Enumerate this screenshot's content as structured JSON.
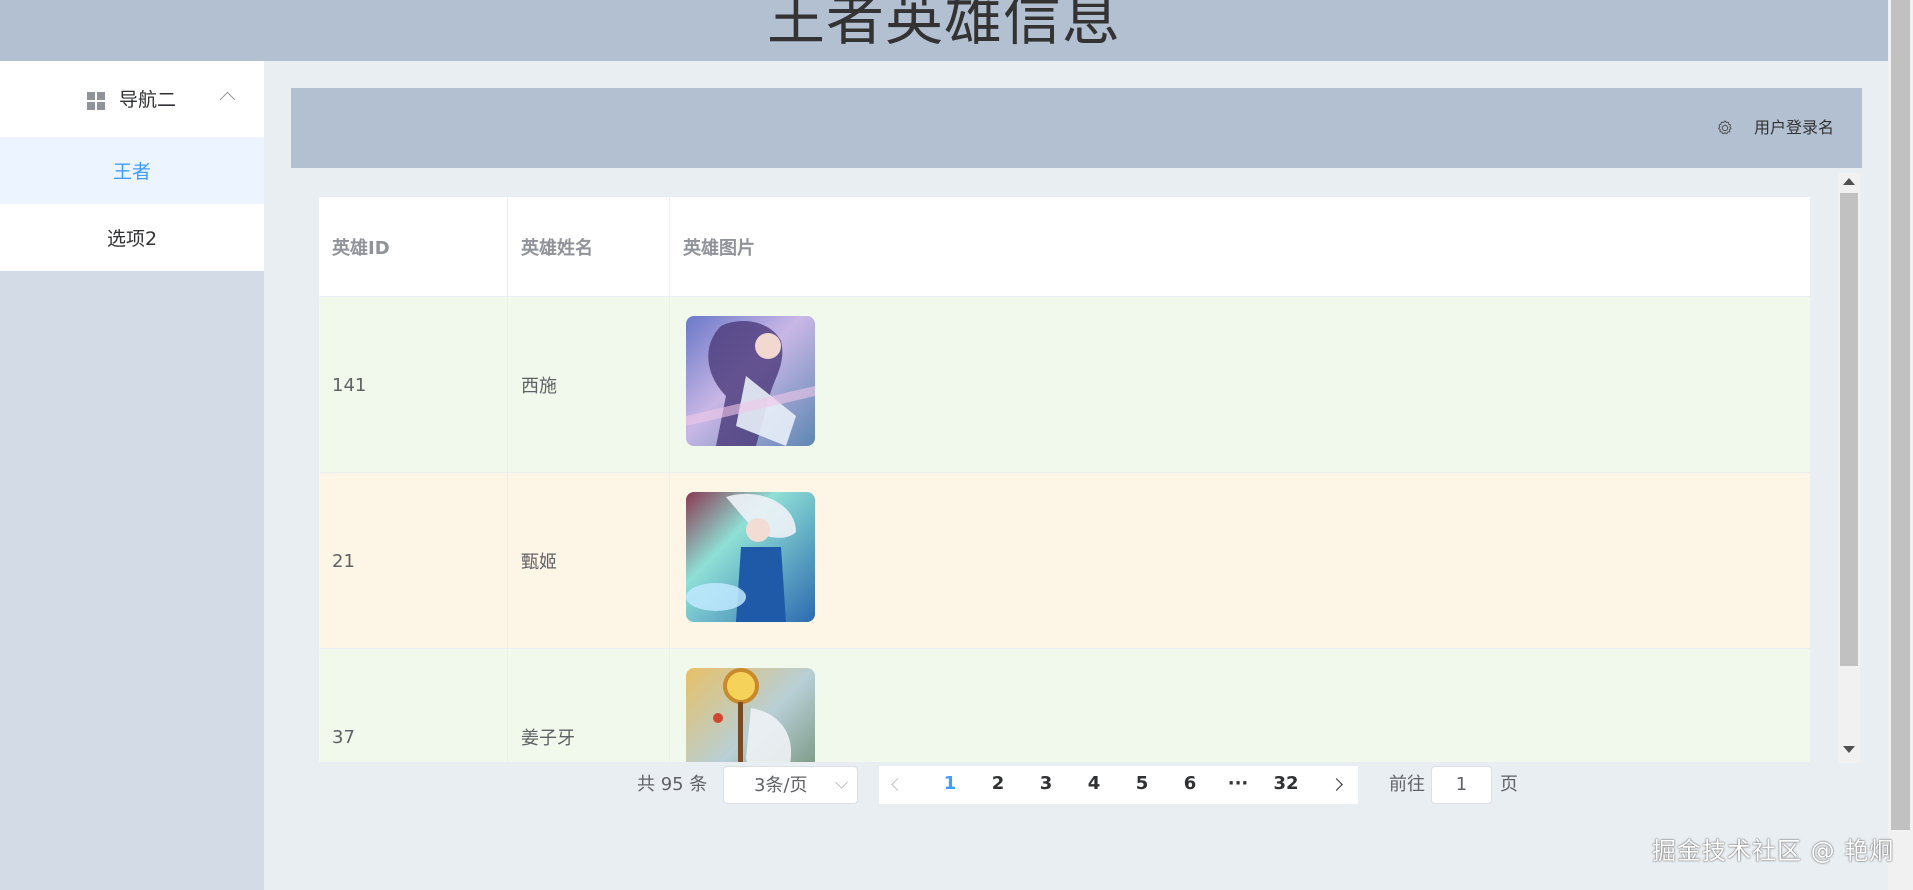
{
  "header": {
    "title": "王者英雄信息"
  },
  "sidebar": {
    "submenu": {
      "label": "导航二"
    },
    "items": [
      {
        "label": "王者",
        "active": true
      },
      {
        "label": "选项2",
        "active": false
      }
    ]
  },
  "topbar": {
    "user_label": "用户登录名"
  },
  "table": {
    "columns": [
      "英雄ID",
      "英雄姓名",
      "英雄图片"
    ],
    "rows": [
      {
        "id": "141",
        "name": "西施"
      },
      {
        "id": "21",
        "name": "甄姬"
      },
      {
        "id": "37",
        "name": "姜子牙"
      }
    ]
  },
  "pagination": {
    "total": "共 95 条",
    "page_size": "3条/页",
    "pages": [
      "1",
      "2",
      "3",
      "4",
      "5",
      "6",
      "···",
      "32"
    ],
    "current": "1",
    "jump_prefix": "前往",
    "jump_value": "1",
    "jump_suffix": "页"
  },
  "watermark": "掘金技术社区 @ 艳炯",
  "colors": {
    "header_bg": "#b3c0d1",
    "sidebar_bg": "#d3dce6",
    "main_bg": "#e9eef3",
    "accent": "#409eff",
    "row_success": "#f0f9eb",
    "row_warning": "#fdf5e6"
  }
}
